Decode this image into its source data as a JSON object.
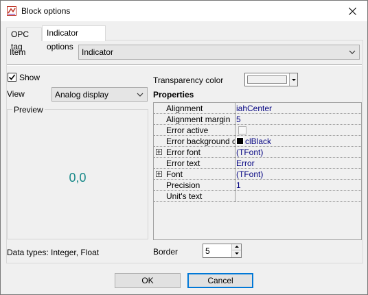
{
  "window": {
    "title": "Block options",
    "icon": "block-options-app-icon",
    "close_icon": "close-icon"
  },
  "tabs": [
    {
      "label": "OPC tag",
      "active": false
    },
    {
      "label": "Indicator options",
      "active": true
    }
  ],
  "item": {
    "label": "Item",
    "value": "Indicator"
  },
  "show": {
    "label": "Show",
    "checked": true
  },
  "view": {
    "label": "View",
    "value": "Analog display"
  },
  "preview": {
    "title": "Preview",
    "value": "0,0",
    "value_color": "#1a8a8a"
  },
  "data_types": "Data types: Integer, Float",
  "transparency": {
    "label": "Transparency color",
    "color": "#f0f0f0"
  },
  "properties": {
    "title": "Properties",
    "rows": [
      {
        "name": "Alignment",
        "value": "iahCenter",
        "expandable": false
      },
      {
        "name": "Alignment margin",
        "value": "5",
        "expandable": false
      },
      {
        "name": "Error active",
        "value": "",
        "type": "checkbox",
        "checked": false,
        "expandable": false
      },
      {
        "name": "Error background col",
        "value": "clBlack",
        "type": "color",
        "color": "#000000",
        "expandable": false
      },
      {
        "name": "Error font",
        "value": "(TFont)",
        "expandable": true
      },
      {
        "name": "Error text",
        "value": "Error",
        "expandable": false
      },
      {
        "name": "Font",
        "value": "(TFont)",
        "expandable": true
      },
      {
        "name": "Precision",
        "value": "1",
        "expandable": false
      },
      {
        "name": "Unit's text",
        "value": "",
        "expandable": false
      }
    ]
  },
  "border": {
    "label": "Border",
    "value": "5"
  },
  "buttons": {
    "ok": "OK",
    "cancel": "Cancel"
  },
  "colors": {
    "accent": "#0078d7",
    "value_text": "#000080"
  }
}
